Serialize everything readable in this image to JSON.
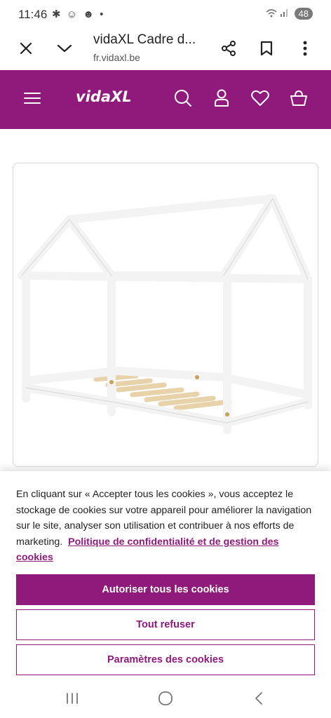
{
  "status_bar": {
    "time": "11:46",
    "battery": "48"
  },
  "browser": {
    "title": "vidaXL Cadre d...",
    "url": "fr.vidaxl.be"
  },
  "site_header": {
    "logo_text": "vidaXL",
    "accent_color": "#8f1a7b"
  },
  "product": {
    "image_alt": "white house-shaped bed frame with wooden slats"
  },
  "cookie_banner": {
    "text": "En cliquant sur « Accepter tous les cookies », vous acceptez le stockage de cookies sur votre appareil pour améliorer la navigation sur le site, analyser son utilisation et contribuer à nos efforts de marketing.",
    "policy_link": "Politique de confidentialité et de gestion des cookies",
    "accept_all": "Autoriser tous les cookies",
    "refuse_all": "Tout refuser",
    "settings": "Paramètres des cookies"
  },
  "icons": {
    "close": "close-icon",
    "collapse": "chevron-down-icon",
    "share": "share-icon",
    "bookmark": "bookmark-icon",
    "more": "more-vertical-icon",
    "menu": "hamburger-menu-icon",
    "search": "search-icon",
    "account": "user-icon",
    "wishlist": "heart-icon",
    "cart": "basket-icon"
  }
}
